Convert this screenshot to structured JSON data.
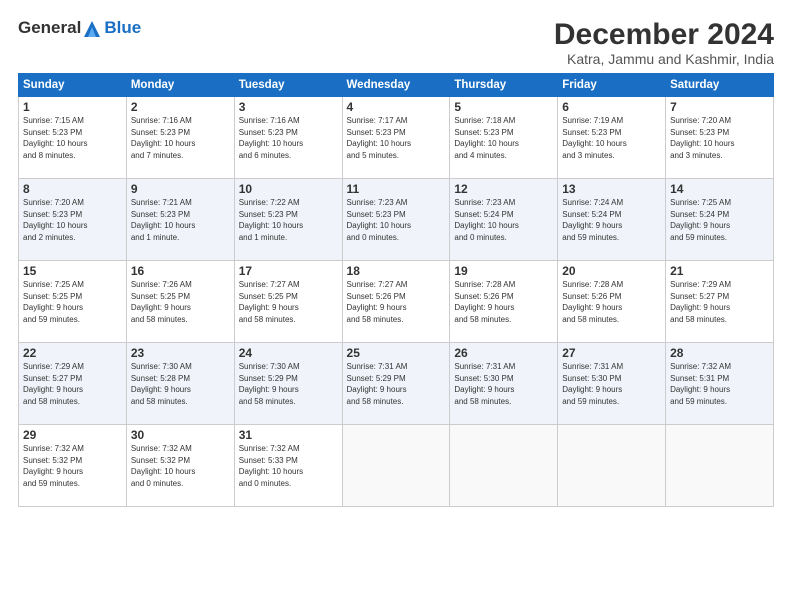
{
  "logo": {
    "line1": "General",
    "line2": "Blue"
  },
  "title": "December 2024",
  "subtitle": "Katra, Jammu and Kashmir, India",
  "days_of_week": [
    "Sunday",
    "Monday",
    "Tuesday",
    "Wednesday",
    "Thursday",
    "Friday",
    "Saturday"
  ],
  "weeks": [
    [
      {
        "day": "1",
        "info": "Sunrise: 7:15 AM\nSunset: 5:23 PM\nDaylight: 10 hours\nand 8 minutes."
      },
      {
        "day": "2",
        "info": "Sunrise: 7:16 AM\nSunset: 5:23 PM\nDaylight: 10 hours\nand 7 minutes."
      },
      {
        "day": "3",
        "info": "Sunrise: 7:16 AM\nSunset: 5:23 PM\nDaylight: 10 hours\nand 6 minutes."
      },
      {
        "day": "4",
        "info": "Sunrise: 7:17 AM\nSunset: 5:23 PM\nDaylight: 10 hours\nand 5 minutes."
      },
      {
        "day": "5",
        "info": "Sunrise: 7:18 AM\nSunset: 5:23 PM\nDaylight: 10 hours\nand 4 minutes."
      },
      {
        "day": "6",
        "info": "Sunrise: 7:19 AM\nSunset: 5:23 PM\nDaylight: 10 hours\nand 3 minutes."
      },
      {
        "day": "7",
        "info": "Sunrise: 7:20 AM\nSunset: 5:23 PM\nDaylight: 10 hours\nand 3 minutes."
      }
    ],
    [
      {
        "day": "8",
        "info": "Sunrise: 7:20 AM\nSunset: 5:23 PM\nDaylight: 10 hours\nand 2 minutes."
      },
      {
        "day": "9",
        "info": "Sunrise: 7:21 AM\nSunset: 5:23 PM\nDaylight: 10 hours\nand 1 minute."
      },
      {
        "day": "10",
        "info": "Sunrise: 7:22 AM\nSunset: 5:23 PM\nDaylight: 10 hours\nand 1 minute."
      },
      {
        "day": "11",
        "info": "Sunrise: 7:23 AM\nSunset: 5:23 PM\nDaylight: 10 hours\nand 0 minutes."
      },
      {
        "day": "12",
        "info": "Sunrise: 7:23 AM\nSunset: 5:24 PM\nDaylight: 10 hours\nand 0 minutes."
      },
      {
        "day": "13",
        "info": "Sunrise: 7:24 AM\nSunset: 5:24 PM\nDaylight: 9 hours\nand 59 minutes."
      },
      {
        "day": "14",
        "info": "Sunrise: 7:25 AM\nSunset: 5:24 PM\nDaylight: 9 hours\nand 59 minutes."
      }
    ],
    [
      {
        "day": "15",
        "info": "Sunrise: 7:25 AM\nSunset: 5:25 PM\nDaylight: 9 hours\nand 59 minutes."
      },
      {
        "day": "16",
        "info": "Sunrise: 7:26 AM\nSunset: 5:25 PM\nDaylight: 9 hours\nand 58 minutes."
      },
      {
        "day": "17",
        "info": "Sunrise: 7:27 AM\nSunset: 5:25 PM\nDaylight: 9 hours\nand 58 minutes."
      },
      {
        "day": "18",
        "info": "Sunrise: 7:27 AM\nSunset: 5:26 PM\nDaylight: 9 hours\nand 58 minutes."
      },
      {
        "day": "19",
        "info": "Sunrise: 7:28 AM\nSunset: 5:26 PM\nDaylight: 9 hours\nand 58 minutes."
      },
      {
        "day": "20",
        "info": "Sunrise: 7:28 AM\nSunset: 5:26 PM\nDaylight: 9 hours\nand 58 minutes."
      },
      {
        "day": "21",
        "info": "Sunrise: 7:29 AM\nSunset: 5:27 PM\nDaylight: 9 hours\nand 58 minutes."
      }
    ],
    [
      {
        "day": "22",
        "info": "Sunrise: 7:29 AM\nSunset: 5:27 PM\nDaylight: 9 hours\nand 58 minutes."
      },
      {
        "day": "23",
        "info": "Sunrise: 7:30 AM\nSunset: 5:28 PM\nDaylight: 9 hours\nand 58 minutes."
      },
      {
        "day": "24",
        "info": "Sunrise: 7:30 AM\nSunset: 5:29 PM\nDaylight: 9 hours\nand 58 minutes."
      },
      {
        "day": "25",
        "info": "Sunrise: 7:31 AM\nSunset: 5:29 PM\nDaylight: 9 hours\nand 58 minutes."
      },
      {
        "day": "26",
        "info": "Sunrise: 7:31 AM\nSunset: 5:30 PM\nDaylight: 9 hours\nand 58 minutes."
      },
      {
        "day": "27",
        "info": "Sunrise: 7:31 AM\nSunset: 5:30 PM\nDaylight: 9 hours\nand 59 minutes."
      },
      {
        "day": "28",
        "info": "Sunrise: 7:32 AM\nSunset: 5:31 PM\nDaylight: 9 hours\nand 59 minutes."
      }
    ],
    [
      {
        "day": "29",
        "info": "Sunrise: 7:32 AM\nSunset: 5:32 PM\nDaylight: 9 hours\nand 59 minutes."
      },
      {
        "day": "30",
        "info": "Sunrise: 7:32 AM\nSunset: 5:32 PM\nDaylight: 10 hours\nand 0 minutes."
      },
      {
        "day": "31",
        "info": "Sunrise: 7:32 AM\nSunset: 5:33 PM\nDaylight: 10 hours\nand 0 minutes."
      },
      null,
      null,
      null,
      null
    ]
  ]
}
